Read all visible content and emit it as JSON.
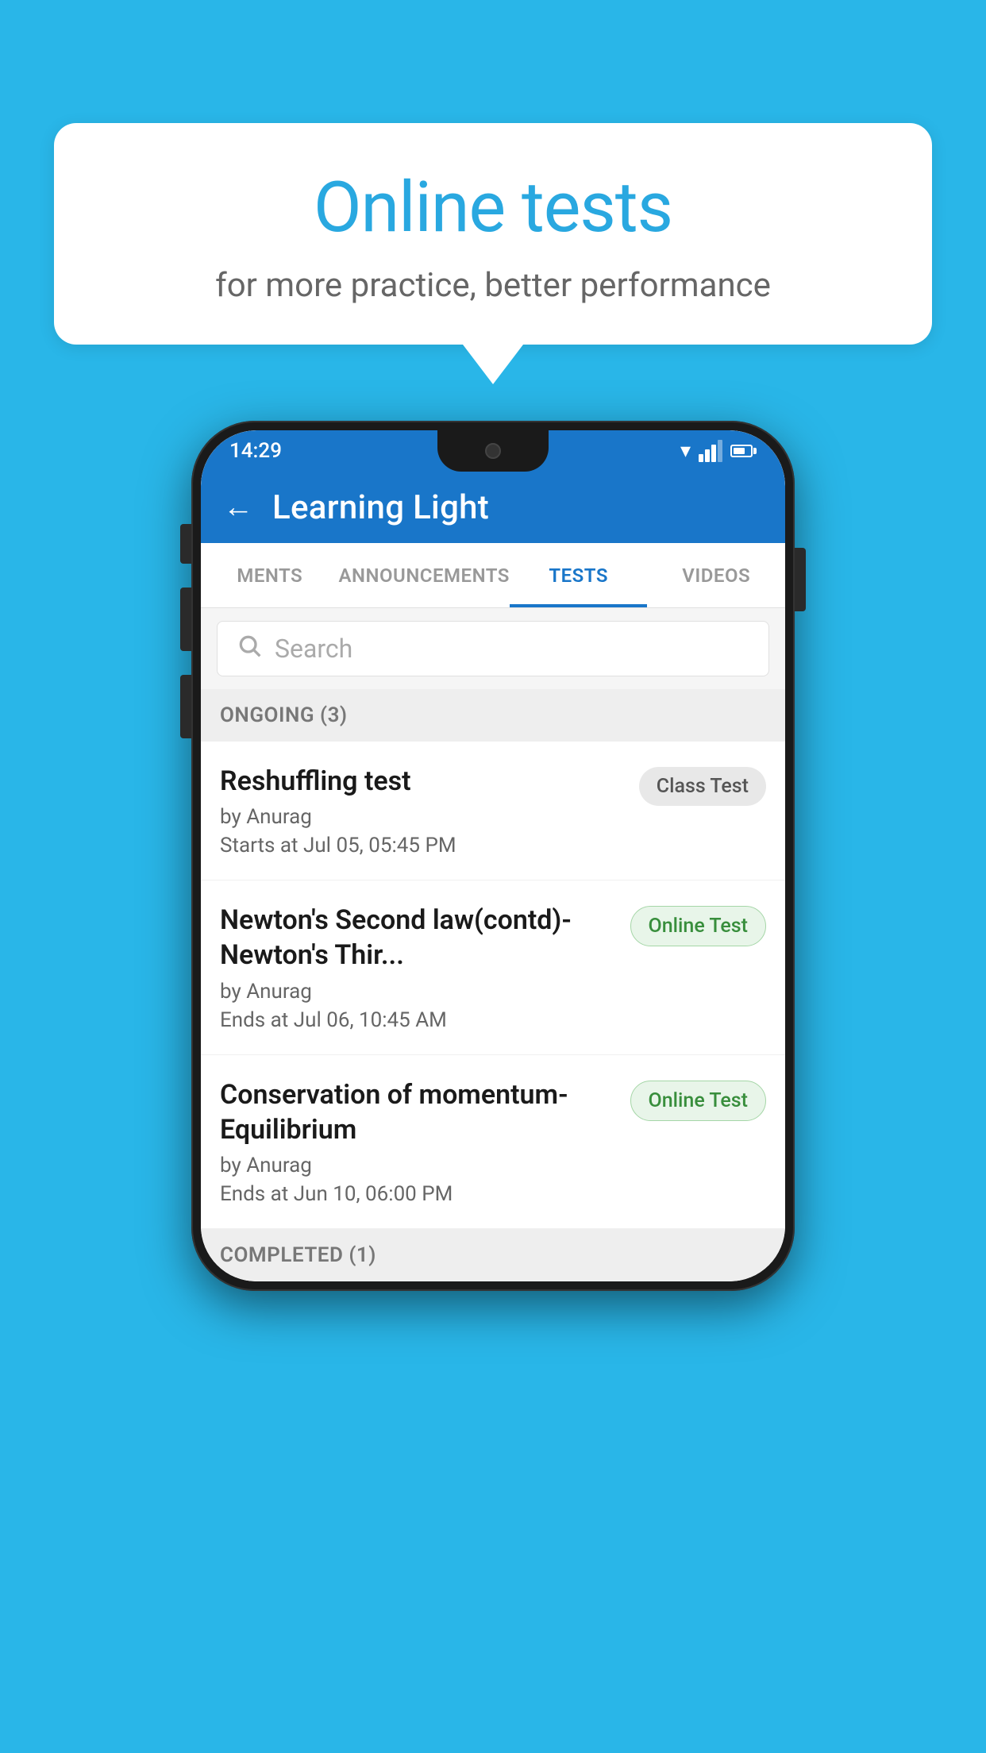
{
  "background_color": "#29b6e8",
  "speech_bubble": {
    "title": "Online tests",
    "subtitle": "for more practice, better performance"
  },
  "phone": {
    "status_bar": {
      "time": "14:29"
    },
    "app_bar": {
      "back_label": "←",
      "title": "Learning Light"
    },
    "tabs": [
      {
        "label": "MENTS",
        "active": false
      },
      {
        "label": "ANNOUNCEMENTS",
        "active": false
      },
      {
        "label": "TESTS",
        "active": true
      },
      {
        "label": "VIDEOS",
        "active": false
      }
    ],
    "search": {
      "placeholder": "Search"
    },
    "ongoing_section": {
      "header": "ONGOING (3)",
      "tests": [
        {
          "title": "Reshuffling test",
          "author": "by Anurag",
          "date": "Starts at  Jul 05, 05:45 PM",
          "badge": "Class Test",
          "badge_type": "class"
        },
        {
          "title": "Newton's Second law(contd)-Newton's Thir...",
          "author": "by Anurag",
          "date": "Ends at  Jul 06, 10:45 AM",
          "badge": "Online Test",
          "badge_type": "online"
        },
        {
          "title": "Conservation of momentum-Equilibrium",
          "author": "by Anurag",
          "date": "Ends at  Jun 10, 06:00 PM",
          "badge": "Online Test",
          "badge_type": "online"
        }
      ]
    },
    "completed_section": {
      "header": "COMPLETED (1)"
    }
  }
}
